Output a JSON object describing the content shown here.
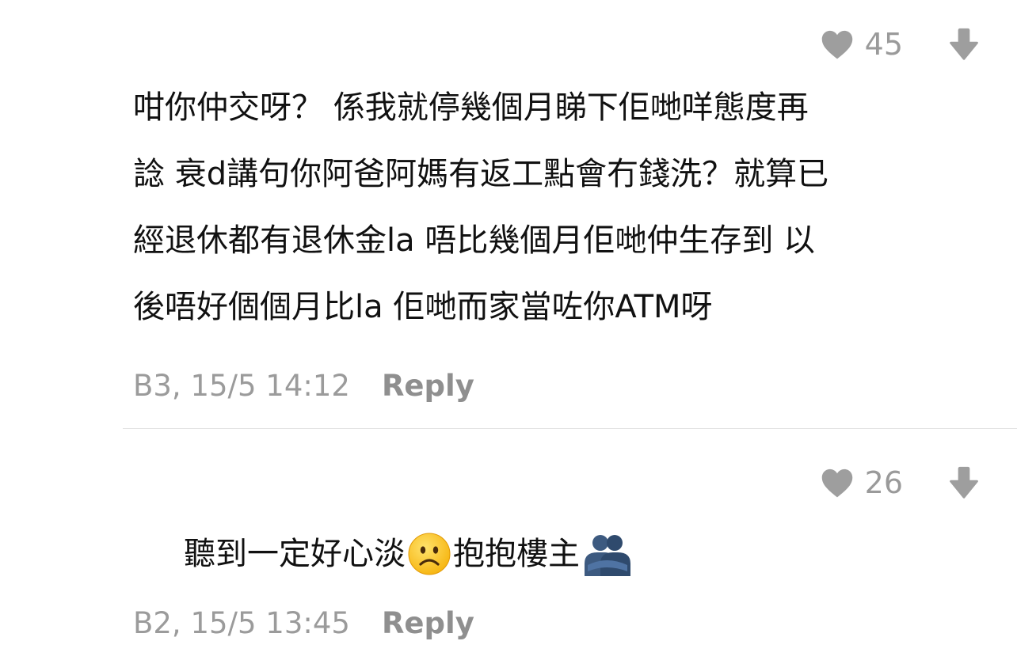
{
  "comments": [
    {
      "likes": "45",
      "lines": [
        "咁你仲交呀？ 係我就停幾個月睇下佢哋咩態度再",
        "諗 衰d講句你阿爸阿媽有返工點會冇錢洗？就算已",
        "經退休都有退休金la 唔比幾個月佢哋仲生存到 以",
        "後唔好個個月比la 佢哋而家當咗你ATM呀"
      ],
      "meta": "B3, 15/5 14:12",
      "reply_label": "Reply"
    },
    {
      "likes": "26",
      "text_part1": "聽到一定好心淡",
      "text_part2": "抱抱樓主",
      "emojis": [
        "frowning-face-emoji",
        "people-hugging-emoji"
      ],
      "meta": "B2, 15/5 13:45",
      "reply_label": "Reply"
    }
  ],
  "colors": {
    "icon_gray": "#9e9e9e",
    "text": "#111111",
    "meta_gray": "#9b9b9b",
    "divider": "#e3e3e3"
  },
  "icons": [
    "heart-icon",
    "down-arrow-icon"
  ]
}
